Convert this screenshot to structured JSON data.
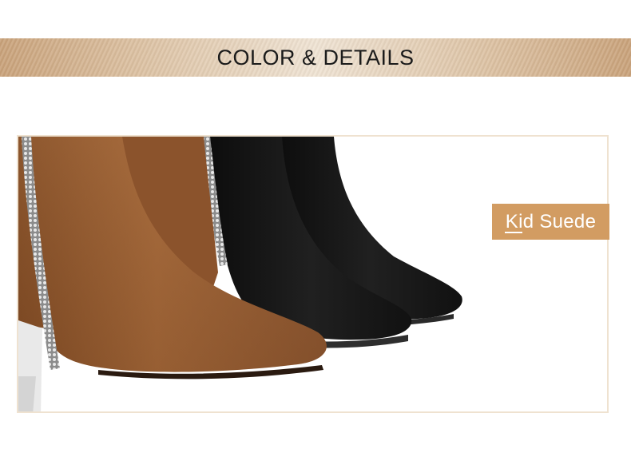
{
  "banner": {
    "title": "COLOR & DETAILS"
  },
  "product_photo": {
    "subject": "brown-and-black-suede-pointed-toe-ankle-boots",
    "colors": {
      "brown_suede": "#9a5f33",
      "black_suede": "#151515",
      "accent_tag": "#d29c62",
      "frame_border": "#efe2d0"
    }
  },
  "material_tag": {
    "label": "Kid Suede"
  }
}
